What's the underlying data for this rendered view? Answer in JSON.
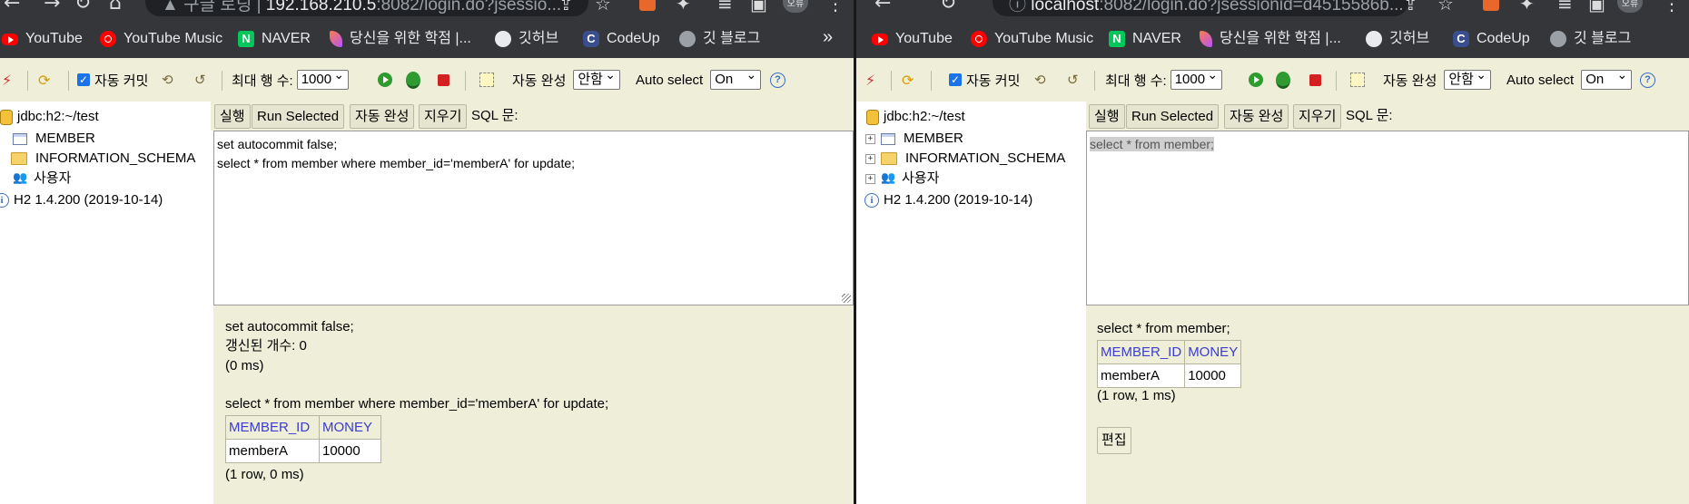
{
  "left": {
    "omnibox": {
      "host": "192.168.210.5",
      "rest": ":8082/login.do?jsessio..."
    },
    "tab_title_fragment": "구글 로딩",
    "editor_lines": [
      "set autocommit false;",
      "select * from member where member_id='memberA' for update;"
    ],
    "results": {
      "stmt1": "set autocommit false;",
      "stmt1_count": "갱신된 개수: 0",
      "stmt1_time": "(0 ms)",
      "stmt2": "select * from member where member_id='memberA' for update;",
      "headers": [
        "MEMBER_ID",
        "MONEY"
      ],
      "rows": [
        [
          "memberA",
          "10000"
        ]
      ],
      "summary": "(1 row, 0 ms)"
    }
  },
  "right": {
    "omnibox": {
      "host": "localhost",
      "rest": ":8082/login.do?jsessionid=d4515586b..."
    },
    "editor_lines": [
      "select * from member;"
    ],
    "results": {
      "stmt": "select * from member;",
      "headers": [
        "MEMBER_ID",
        "MONEY"
      ],
      "rows": [
        [
          "memberA",
          "10000"
        ]
      ],
      "summary": "(1 row, 1 ms)",
      "edit_button": "편집"
    }
  },
  "profile": "오류",
  "bookmarks": [
    "YouTube",
    "YouTube Music",
    "NAVER",
    "당신을 위한 학점 |...",
    "깃허브",
    "CodeUp",
    "깃 블로그"
  ],
  "bookmarks_more": "»",
  "toolbar": {
    "autocommit_label": "자동 커밋",
    "max_rows_label": "최대 행 수:",
    "max_rows_value": "1000",
    "autocomplete_label": "자동 완성",
    "autocomplete_value": "안함",
    "auto_select_label": "Auto select",
    "auto_select_value": "On",
    "help": "?"
  },
  "tree": {
    "db": "jdbc:h2:~/test",
    "table": "MEMBER",
    "schema": "INFORMATION_SCHEMA",
    "users": "사용자",
    "version": "H2 1.4.200 (2019-10-14)"
  },
  "sqlbar": {
    "run": "실행",
    "run_selected": "Run Selected",
    "autocomplete": "자동 완성",
    "clear": "지우기",
    "sql_label": "SQL 문:"
  },
  "colors": {
    "toolbar_bg": "#eeeed9",
    "chrome_bg": "#35363a",
    "header_link": "#3c3ccf"
  }
}
